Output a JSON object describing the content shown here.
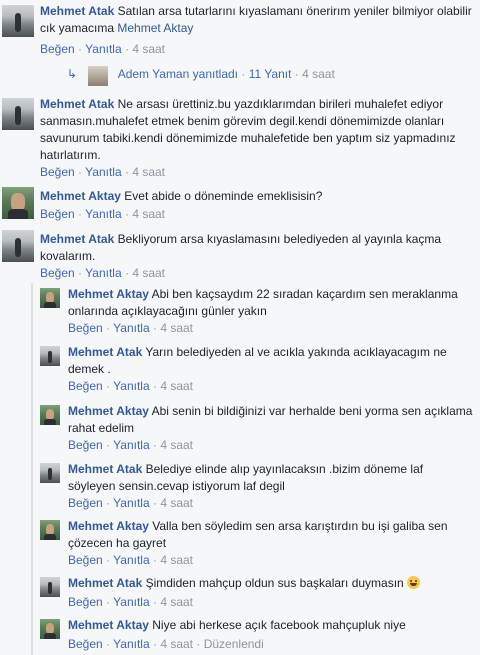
{
  "labels": {
    "like": "Beğen",
    "reply": "Yanıtla",
    "sep": "·",
    "edited": "Düzenlendi"
  },
  "comments": [
    {
      "author": "Mehmet Atak",
      "text": "Satılan arsa tutarlarını kıyaslamanı önerirım yeniler bilmiyor olabilir cık yamacıma",
      "mention": "Mehmet Aktay",
      "time": "4 saat"
    },
    {
      "reply_summary": {
        "name": "Adem Yaman",
        "action": "yanıtladı",
        "count": "11 Yanıt",
        "time": "4 saat"
      }
    },
    {
      "author": "Mehmet Atak",
      "text": "Ne arsası ürettiniz.bu yazdıklarımdan birileri muhalefet ediyor sanmasın.muhalefet etmek benim görevim degil.kendi dönemimizde olanları savunurum tabiki.kendi dönemimizde muhalefetide ben yaptım siz yapmadınız hatırlatırım.",
      "time": "4 saat"
    },
    {
      "author": "Mehmet Aktay",
      "text": "Evet abide o döneminde emeklisisin?",
      "time": "4 saat"
    },
    {
      "author": "Mehmet Atak",
      "text": "Bekliyorum arsa kıyaslamasını belediyeden al yayınla kaçma kovalarım.",
      "time": "4 saat"
    }
  ],
  "replies": [
    {
      "author": "Mehmet Aktay",
      "text": "Abi ben kaçsaydım 22 sıradan kaçardım sen meraklanma onlarında açıklayacağını günler yakın",
      "time": "4 saat"
    },
    {
      "author": "Mehmet Atak",
      "text": "Yarın belediyeden al ve acıkla yakında acıklayacagım ne demek .",
      "time": "4 saat"
    },
    {
      "author": "Mehmet Aktay",
      "text": "Abi senin bi bildiğinizi var herhalde beni yorma sen açıklama rahat edelim",
      "time": "4 saat"
    },
    {
      "author": "Mehmet Atak",
      "text": "Belediye elinde alıp yayınlacaksın .bizim döneme laf söyleyen sensin.cevap istiyorum laf degil",
      "time": "4 saat"
    },
    {
      "author": "Mehmet Aktay",
      "text": "Valla ben söyledim sen arsa karıştırdın bu işi galiba sen çözecen ha gayret",
      "time": "4 saat"
    },
    {
      "author": "Mehmet Atak",
      "text": "Şimdiden mahçup oldun sus başkaları duymasın",
      "time": "4 saat"
    },
    {
      "author": "Mehmet Aktay",
      "text": "Niye abi herkese açık facebook mahçupluk niye",
      "time": "4 saat"
    }
  ]
}
